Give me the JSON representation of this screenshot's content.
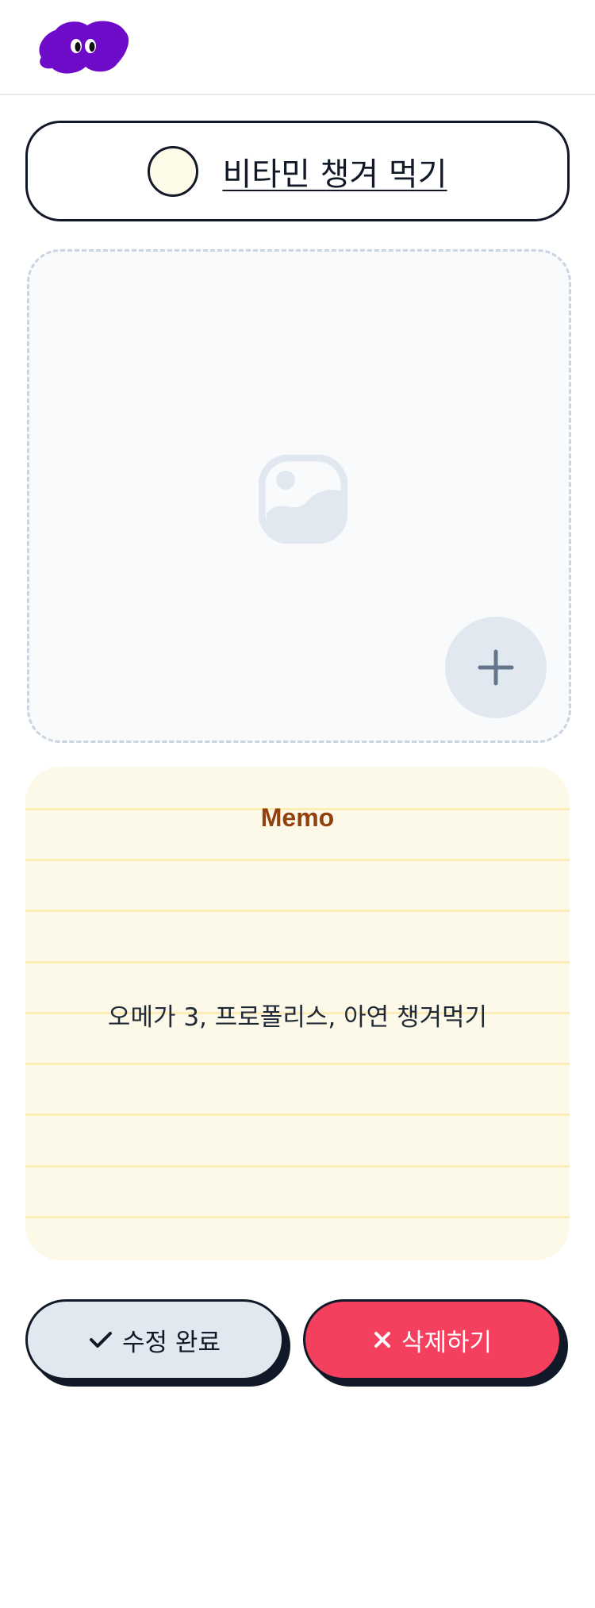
{
  "app": {
    "logo_icon": "purple-blob-character-logo",
    "brand_color": "#6d0bc9"
  },
  "task": {
    "title": "비타민 챙겨 먹기",
    "completed": false
  },
  "photo": {
    "placeholder_icon": "image-placeholder-icon",
    "add_icon": "plus-icon"
  },
  "memo": {
    "label": "Memo",
    "text": "오메가 3, 프로폴리스, 아연 챙겨먹기"
  },
  "actions": {
    "save_label": "수정 완료",
    "save_icon": "check-icon",
    "delete_label": "삭제하기",
    "delete_icon": "close-icon",
    "delete_color": "#f43f5e"
  }
}
